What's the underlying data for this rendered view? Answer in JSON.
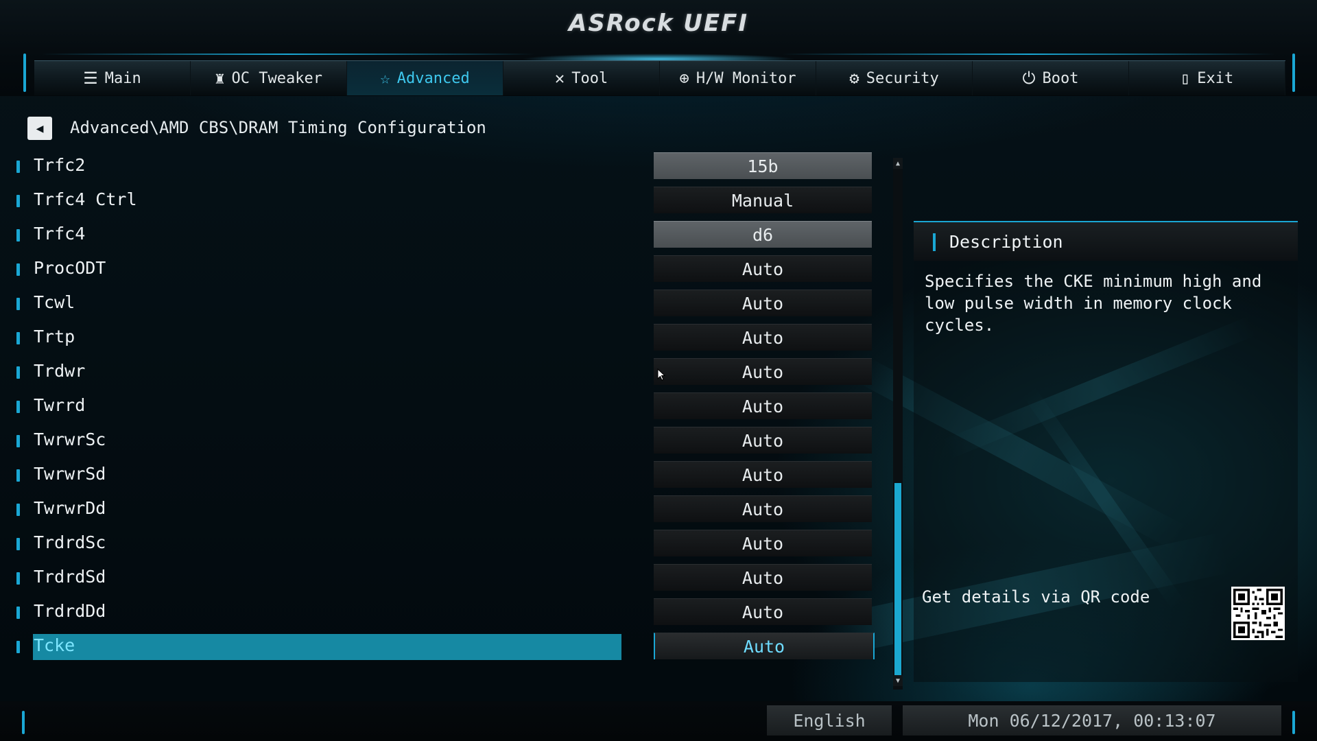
{
  "header": {
    "logo_text": "ASRock UEFI"
  },
  "tabs": [
    {
      "label": "Main",
      "icon": "list-icon",
      "active": false
    },
    {
      "label": "OC Tweaker",
      "icon": "rocket-icon",
      "active": false
    },
    {
      "label": "Advanced",
      "icon": "star-icon",
      "active": true
    },
    {
      "label": "Tool",
      "icon": "wrench-icon",
      "active": false
    },
    {
      "label": "H/W Monitor",
      "icon": "crosshair-icon",
      "active": false
    },
    {
      "label": "Security",
      "icon": "shield-icon",
      "active": false
    },
    {
      "label": "Boot",
      "icon": "power-icon",
      "active": false
    },
    {
      "label": "Exit",
      "icon": "exit-door-icon",
      "active": false
    }
  ],
  "breadcrumb": {
    "path": "Advanced\\AMD CBS\\DRAM Timing Configuration"
  },
  "settings": [
    {
      "label": "Trfc2",
      "value": "15b"
    },
    {
      "label": "Trfc4 Ctrl",
      "value": "Manual"
    },
    {
      "label": "Trfc4",
      "value": "d6"
    },
    {
      "label": "ProcODT",
      "value": "Auto"
    },
    {
      "label": "Tcwl",
      "value": "Auto"
    },
    {
      "label": "Trtp",
      "value": "Auto"
    },
    {
      "label": "Trdwr",
      "value": "Auto"
    },
    {
      "label": "Twrrd",
      "value": "Auto"
    },
    {
      "label": "TwrwrSc",
      "value": "Auto"
    },
    {
      "label": "TwrwrSd",
      "value": "Auto"
    },
    {
      "label": "TwrwrDd",
      "value": "Auto"
    },
    {
      "label": "TrdrdSc",
      "value": "Auto"
    },
    {
      "label": "TrdrdSd",
      "value": "Auto"
    },
    {
      "label": "TrdrdDd",
      "value": "Auto"
    },
    {
      "label": "Tcke",
      "value": "Auto"
    }
  ],
  "description": {
    "title": "Description",
    "text": "Specifies the CKE minimum high and low pulse width in memory clock cycles.",
    "qr_label": "Get details via QR code"
  },
  "footer": {
    "language": "English",
    "datetime": "Mon 06/12/2017, 00:13:07"
  },
  "colors": {
    "accent": "#1aa7d4",
    "selection": "#1689a3",
    "active_tab_text": "#3ec8ee"
  }
}
